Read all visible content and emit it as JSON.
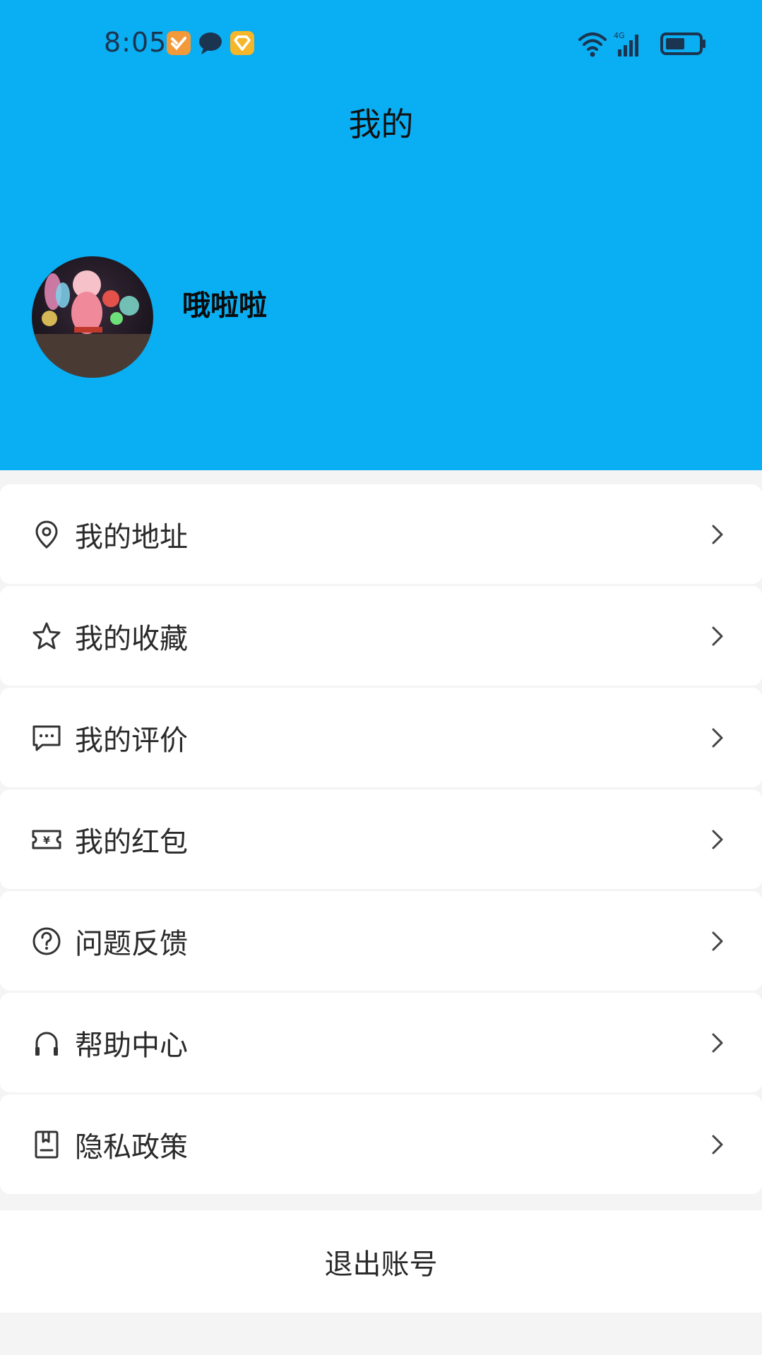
{
  "status_bar": {
    "time": "8:05",
    "network": "4G",
    "notification_icons": [
      "app-badge-orange-icon",
      "chat-bubble-icon",
      "app-badge-yellow-icon"
    ]
  },
  "header": {
    "title": "我的",
    "username": "哦啦啦",
    "accent_color": "#0aaef2"
  },
  "menu": {
    "items": [
      {
        "label": "我的地址",
        "icon": "location-pin-icon"
      },
      {
        "label": "我的收藏",
        "icon": "star-icon"
      },
      {
        "label": "我的评价",
        "icon": "comment-icon"
      },
      {
        "label": "我的红包",
        "icon": "coupon-icon"
      },
      {
        "label": "问题反馈",
        "icon": "question-icon"
      },
      {
        "label": "帮助中心",
        "icon": "headset-icon"
      },
      {
        "label": "隐私政策",
        "icon": "document-icon"
      }
    ]
  },
  "logout_label": "退出账号"
}
